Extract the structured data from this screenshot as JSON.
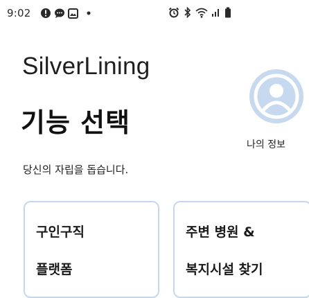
{
  "status_bar": {
    "time": "9:02",
    "notification_icons": [
      "alert-circle-icon",
      "chat-bubble-icon",
      "image-icon",
      "dot-icon"
    ],
    "system_icons": [
      "alarm-icon",
      "bluetooth-icon",
      "wifi-icon",
      "signal-icon",
      "battery-icon"
    ]
  },
  "header": {
    "app_title": "SilverLining",
    "page_title": "기능 선택",
    "subtitle": "당신의 자립을 돕습니다."
  },
  "profile": {
    "label": "나의 정보",
    "icon": "user-avatar-icon"
  },
  "cards": [
    {
      "lines": [
        "구인구직",
        "플랫폼"
      ]
    },
    {
      "lines": [
        "주변 병원 &",
        "복지시설 찾기"
      ]
    }
  ],
  "colors": {
    "accent_light": "#c7d9ee",
    "card_border": "#c4d7ee",
    "avatar_figure": "#ffffff"
  }
}
